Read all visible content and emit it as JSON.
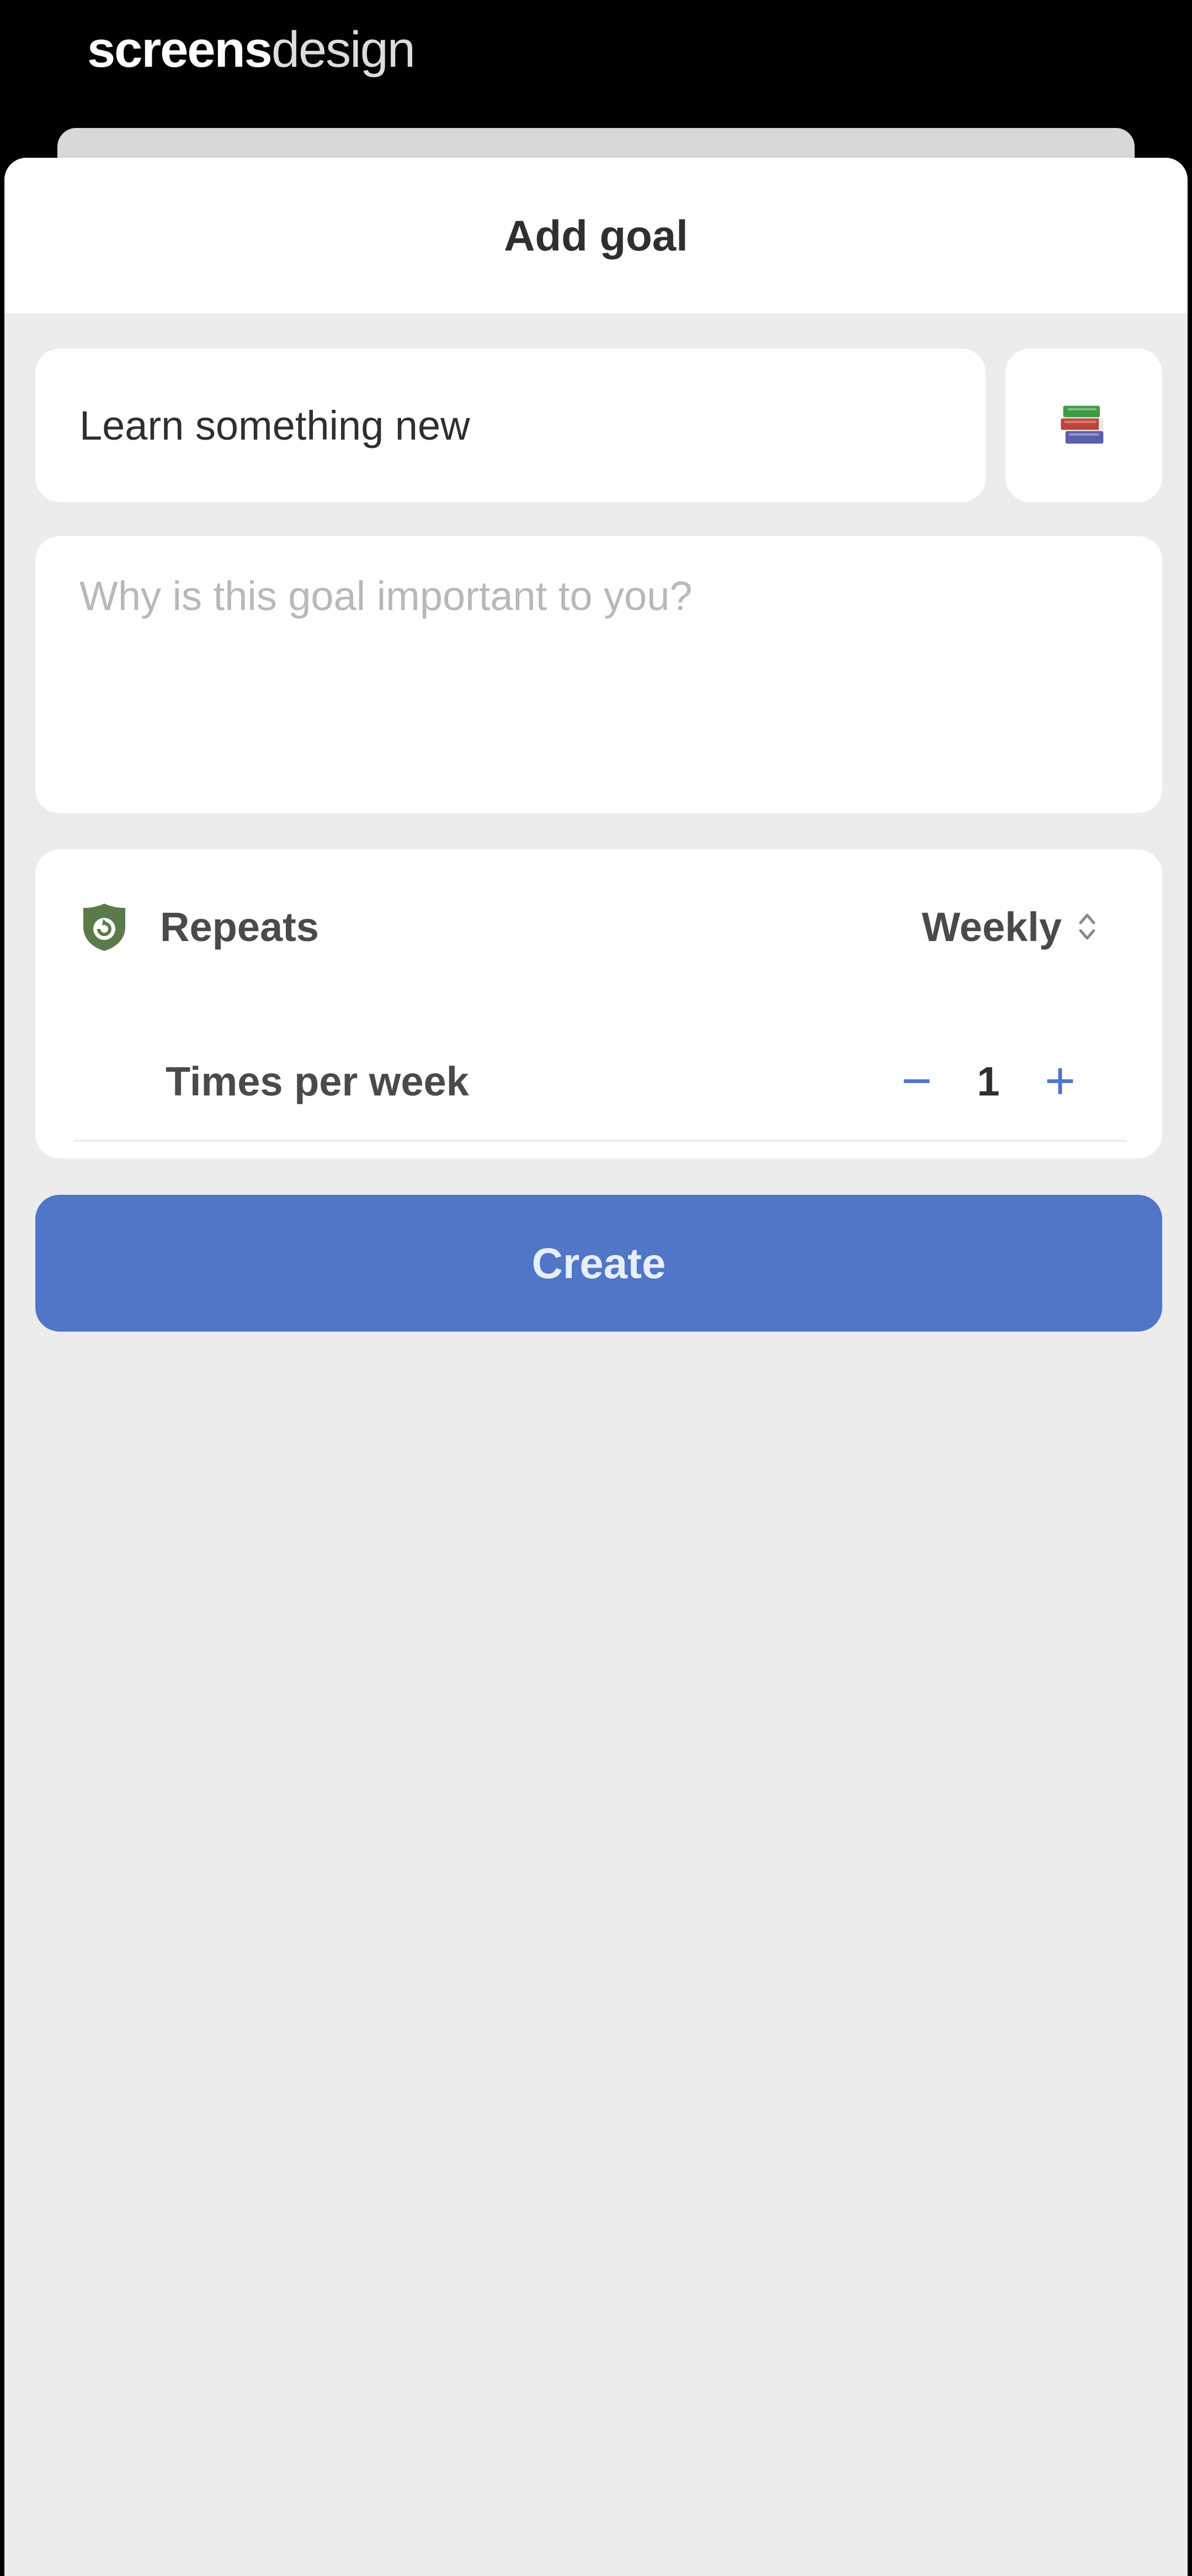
{
  "brand": {
    "part1": "screens",
    "part2": "design"
  },
  "sheet": {
    "title": "Add goal"
  },
  "goal": {
    "name_value": "Learn something new",
    "icon": "books-emoji-icon",
    "why_placeholder": "Why is this goal important to you?"
  },
  "repeat": {
    "label": "Repeats",
    "value": "Weekly",
    "icon": "repeat-badge-icon",
    "times_label": "Times per week",
    "times_value": "1",
    "decrement_symbol": "−",
    "increment_symbol": "+"
  },
  "actions": {
    "create_label": "Create"
  },
  "colors": {
    "accent": "#4f76c7",
    "background": "#ececec",
    "card": "#ffffff",
    "repeat_icon": "#5a7a4a"
  }
}
